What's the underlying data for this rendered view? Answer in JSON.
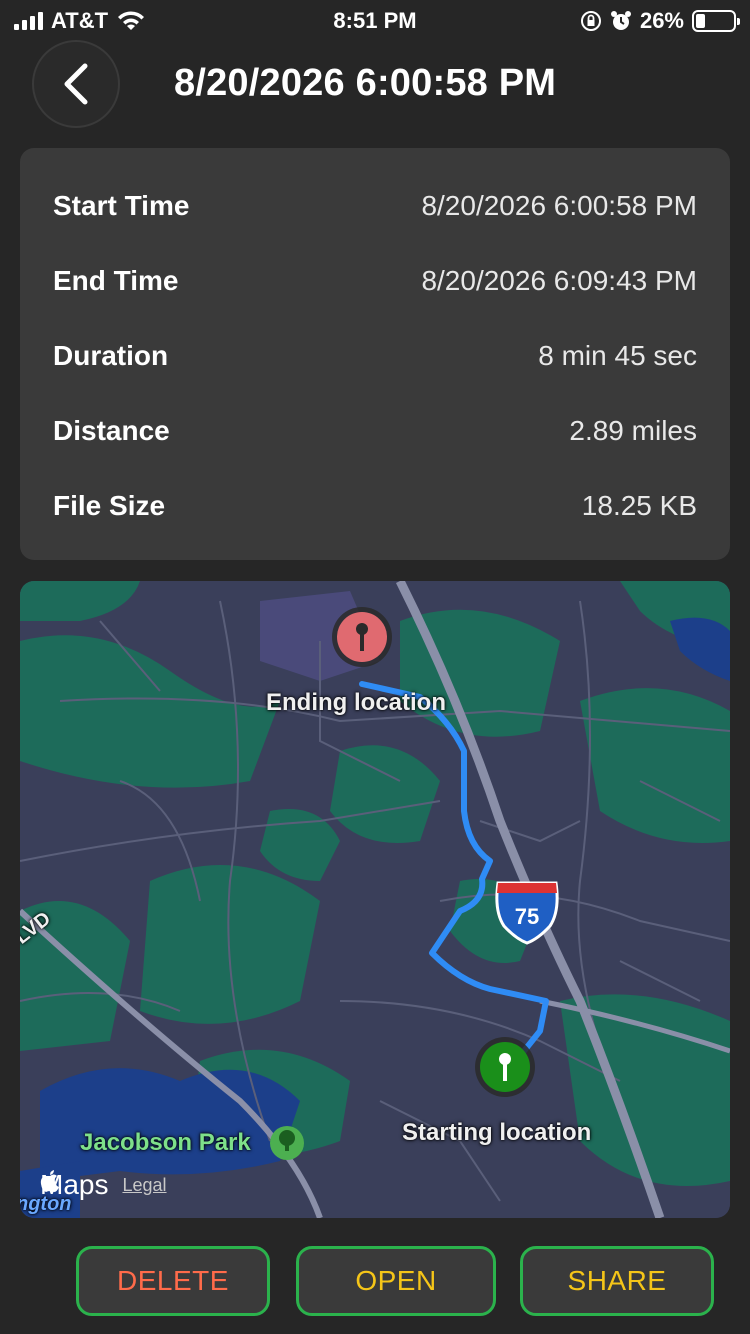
{
  "status_bar": {
    "carrier": "AT&T",
    "time": "8:51 PM",
    "battery_percent": "26%",
    "battery_level": 0.26
  },
  "header": {
    "title": "8/20/2026 6:00:58 PM"
  },
  "details": [
    {
      "label": "Start Time",
      "value": "8/20/2026 6:00:58 PM"
    },
    {
      "label": "End Time",
      "value": "8/20/2026 6:09:43 PM"
    },
    {
      "label": "Duration",
      "value": "8 min 45 sec"
    },
    {
      "label": "Distance",
      "value": "2.89 miles"
    },
    {
      "label": "File Size",
      "value": "18.25 KB"
    }
  ],
  "map": {
    "ending_label": "Ending location",
    "starting_label": "Starting location",
    "park_label": "Jacobson Park",
    "highway_number": "75",
    "road_label": "LVD",
    "town_label": "ngton",
    "maps_label": "Maps",
    "legal_label": "Legal",
    "colors": {
      "route": "#2f8cf5",
      "end_pin": "#e06a70",
      "start_pin": "#1a8f1a",
      "land": "#3a3f5a",
      "green": "#1d6b5a",
      "water": "#1c3f8a"
    }
  },
  "actions": {
    "delete_label": "DELETE",
    "open_label": "OPEN",
    "share_label": "SHARE"
  },
  "icons": {
    "back": "chevron-left-icon",
    "wifi": "wifi-icon",
    "lock": "orientation-lock-icon",
    "alarm": "alarm-icon",
    "battery": "battery-icon",
    "park": "tree-icon",
    "apple": "apple-icon"
  }
}
